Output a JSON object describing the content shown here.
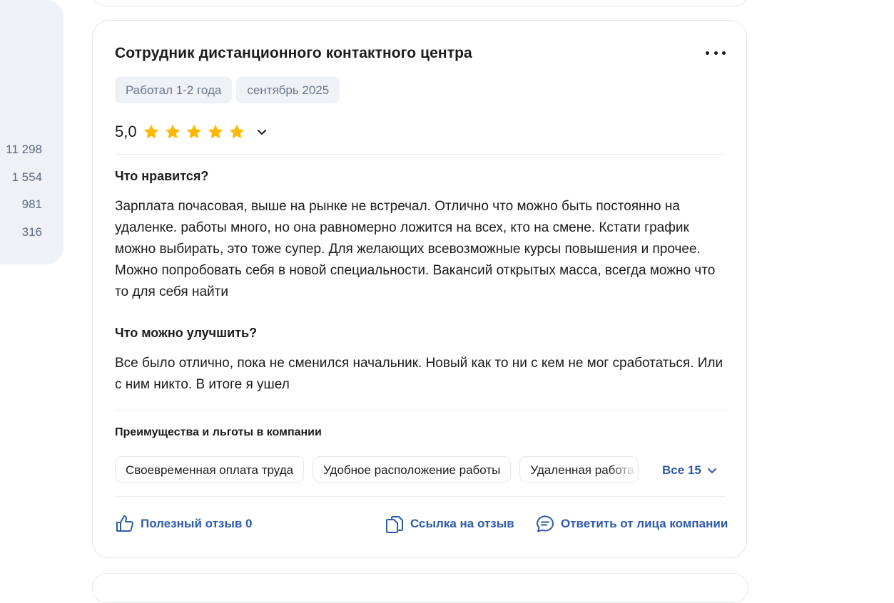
{
  "left_stats": {
    "counts": [
      "11 298",
      "1 554",
      "981",
      "316"
    ]
  },
  "review": {
    "title": "Сотрудник дистанционного контактного центра",
    "tags": [
      "Работал 1-2 года",
      "сентябрь 2025"
    ],
    "rating": {
      "value_label": "5,0",
      "stars": 5,
      "max": 5,
      "star_color": "#FFB800"
    },
    "pros_heading": "Что нравится?",
    "pros_text": "Зарплата почасовая, выше на рынке не встречал. Отлично что можно быть постоянно на удаленке. работы много, но она равномерно ложится на всех, кто на смене. Кстати график можно выбирать, это тоже супер. Для желающих всевозможные курсы повышения и прочее. Можно попробовать себя в новой специальности. Вакансий открытых масса, всегда можно что то для себя найти",
    "cons_heading": "Что можно улучшить?",
    "cons_text": "Все было отлично, пока не сменился начальник. Новый как то ни с кем не мог сработаться. Или с ним никто. В итоге я ушел",
    "benefits_heading": "Преимущества и льготы в компании",
    "benefits": [
      "Своевременная оплата труда",
      "Удобное расположение работы",
      "Удаленная работа"
    ],
    "all_benefits_label": "Все 15",
    "actions": {
      "helpful_label": "Полезный отзыв 0",
      "link_label": "Ссылка на отзыв",
      "reply_label": "Ответить от лица компании"
    },
    "accent_color": "#2E5AAC"
  }
}
